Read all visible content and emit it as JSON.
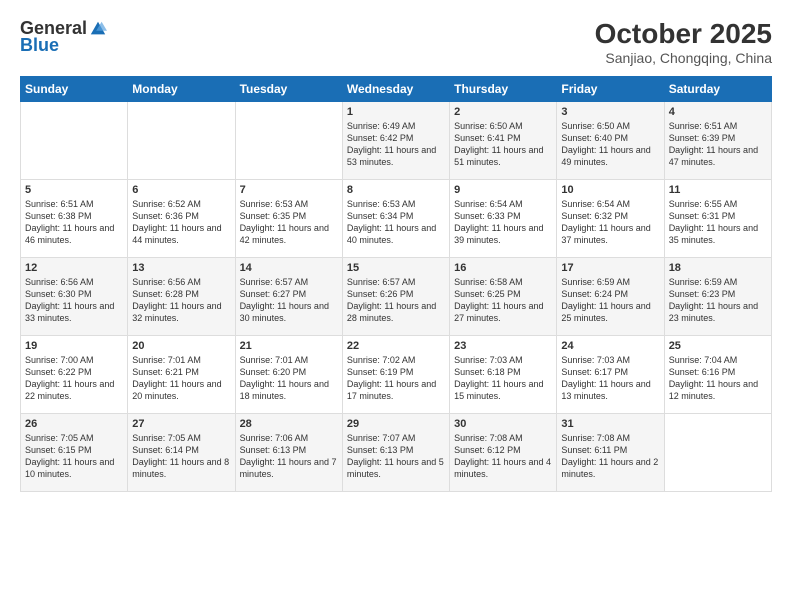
{
  "header": {
    "logo_general": "General",
    "logo_blue": "Blue",
    "month": "October 2025",
    "location": "Sanjiao, Chongqing, China"
  },
  "weekdays": [
    "Sunday",
    "Monday",
    "Tuesday",
    "Wednesday",
    "Thursday",
    "Friday",
    "Saturday"
  ],
  "weeks": [
    [
      {
        "day": "",
        "info": ""
      },
      {
        "day": "",
        "info": ""
      },
      {
        "day": "",
        "info": ""
      },
      {
        "day": "1",
        "info": "Sunrise: 6:49 AM\nSunset: 6:42 PM\nDaylight: 11 hours\nand 53 minutes."
      },
      {
        "day": "2",
        "info": "Sunrise: 6:50 AM\nSunset: 6:41 PM\nDaylight: 11 hours\nand 51 minutes."
      },
      {
        "day": "3",
        "info": "Sunrise: 6:50 AM\nSunset: 6:40 PM\nDaylight: 11 hours\nand 49 minutes."
      },
      {
        "day": "4",
        "info": "Sunrise: 6:51 AM\nSunset: 6:39 PM\nDaylight: 11 hours\nand 47 minutes."
      }
    ],
    [
      {
        "day": "5",
        "info": "Sunrise: 6:51 AM\nSunset: 6:38 PM\nDaylight: 11 hours\nand 46 minutes."
      },
      {
        "day": "6",
        "info": "Sunrise: 6:52 AM\nSunset: 6:36 PM\nDaylight: 11 hours\nand 44 minutes."
      },
      {
        "day": "7",
        "info": "Sunrise: 6:53 AM\nSunset: 6:35 PM\nDaylight: 11 hours\nand 42 minutes."
      },
      {
        "day": "8",
        "info": "Sunrise: 6:53 AM\nSunset: 6:34 PM\nDaylight: 11 hours\nand 40 minutes."
      },
      {
        "day": "9",
        "info": "Sunrise: 6:54 AM\nSunset: 6:33 PM\nDaylight: 11 hours\nand 39 minutes."
      },
      {
        "day": "10",
        "info": "Sunrise: 6:54 AM\nSunset: 6:32 PM\nDaylight: 11 hours\nand 37 minutes."
      },
      {
        "day": "11",
        "info": "Sunrise: 6:55 AM\nSunset: 6:31 PM\nDaylight: 11 hours\nand 35 minutes."
      }
    ],
    [
      {
        "day": "12",
        "info": "Sunrise: 6:56 AM\nSunset: 6:30 PM\nDaylight: 11 hours\nand 33 minutes."
      },
      {
        "day": "13",
        "info": "Sunrise: 6:56 AM\nSunset: 6:28 PM\nDaylight: 11 hours\nand 32 minutes."
      },
      {
        "day": "14",
        "info": "Sunrise: 6:57 AM\nSunset: 6:27 PM\nDaylight: 11 hours\nand 30 minutes."
      },
      {
        "day": "15",
        "info": "Sunrise: 6:57 AM\nSunset: 6:26 PM\nDaylight: 11 hours\nand 28 minutes."
      },
      {
        "day": "16",
        "info": "Sunrise: 6:58 AM\nSunset: 6:25 PM\nDaylight: 11 hours\nand 27 minutes."
      },
      {
        "day": "17",
        "info": "Sunrise: 6:59 AM\nSunset: 6:24 PM\nDaylight: 11 hours\nand 25 minutes."
      },
      {
        "day": "18",
        "info": "Sunrise: 6:59 AM\nSunset: 6:23 PM\nDaylight: 11 hours\nand 23 minutes."
      }
    ],
    [
      {
        "day": "19",
        "info": "Sunrise: 7:00 AM\nSunset: 6:22 PM\nDaylight: 11 hours\nand 22 minutes."
      },
      {
        "day": "20",
        "info": "Sunrise: 7:01 AM\nSunset: 6:21 PM\nDaylight: 11 hours\nand 20 minutes."
      },
      {
        "day": "21",
        "info": "Sunrise: 7:01 AM\nSunset: 6:20 PM\nDaylight: 11 hours\nand 18 minutes."
      },
      {
        "day": "22",
        "info": "Sunrise: 7:02 AM\nSunset: 6:19 PM\nDaylight: 11 hours\nand 17 minutes."
      },
      {
        "day": "23",
        "info": "Sunrise: 7:03 AM\nSunset: 6:18 PM\nDaylight: 11 hours\nand 15 minutes."
      },
      {
        "day": "24",
        "info": "Sunrise: 7:03 AM\nSunset: 6:17 PM\nDaylight: 11 hours\nand 13 minutes."
      },
      {
        "day": "25",
        "info": "Sunrise: 7:04 AM\nSunset: 6:16 PM\nDaylight: 11 hours\nand 12 minutes."
      }
    ],
    [
      {
        "day": "26",
        "info": "Sunrise: 7:05 AM\nSunset: 6:15 PM\nDaylight: 11 hours\nand 10 minutes."
      },
      {
        "day": "27",
        "info": "Sunrise: 7:05 AM\nSunset: 6:14 PM\nDaylight: 11 hours\nand 8 minutes."
      },
      {
        "day": "28",
        "info": "Sunrise: 7:06 AM\nSunset: 6:13 PM\nDaylight: 11 hours\nand 7 minutes."
      },
      {
        "day": "29",
        "info": "Sunrise: 7:07 AM\nSunset: 6:13 PM\nDaylight: 11 hours\nand 5 minutes."
      },
      {
        "day": "30",
        "info": "Sunrise: 7:08 AM\nSunset: 6:12 PM\nDaylight: 11 hours\nand 4 minutes."
      },
      {
        "day": "31",
        "info": "Sunrise: 7:08 AM\nSunset: 6:11 PM\nDaylight: 11 hours\nand 2 minutes."
      },
      {
        "day": "",
        "info": ""
      }
    ]
  ]
}
